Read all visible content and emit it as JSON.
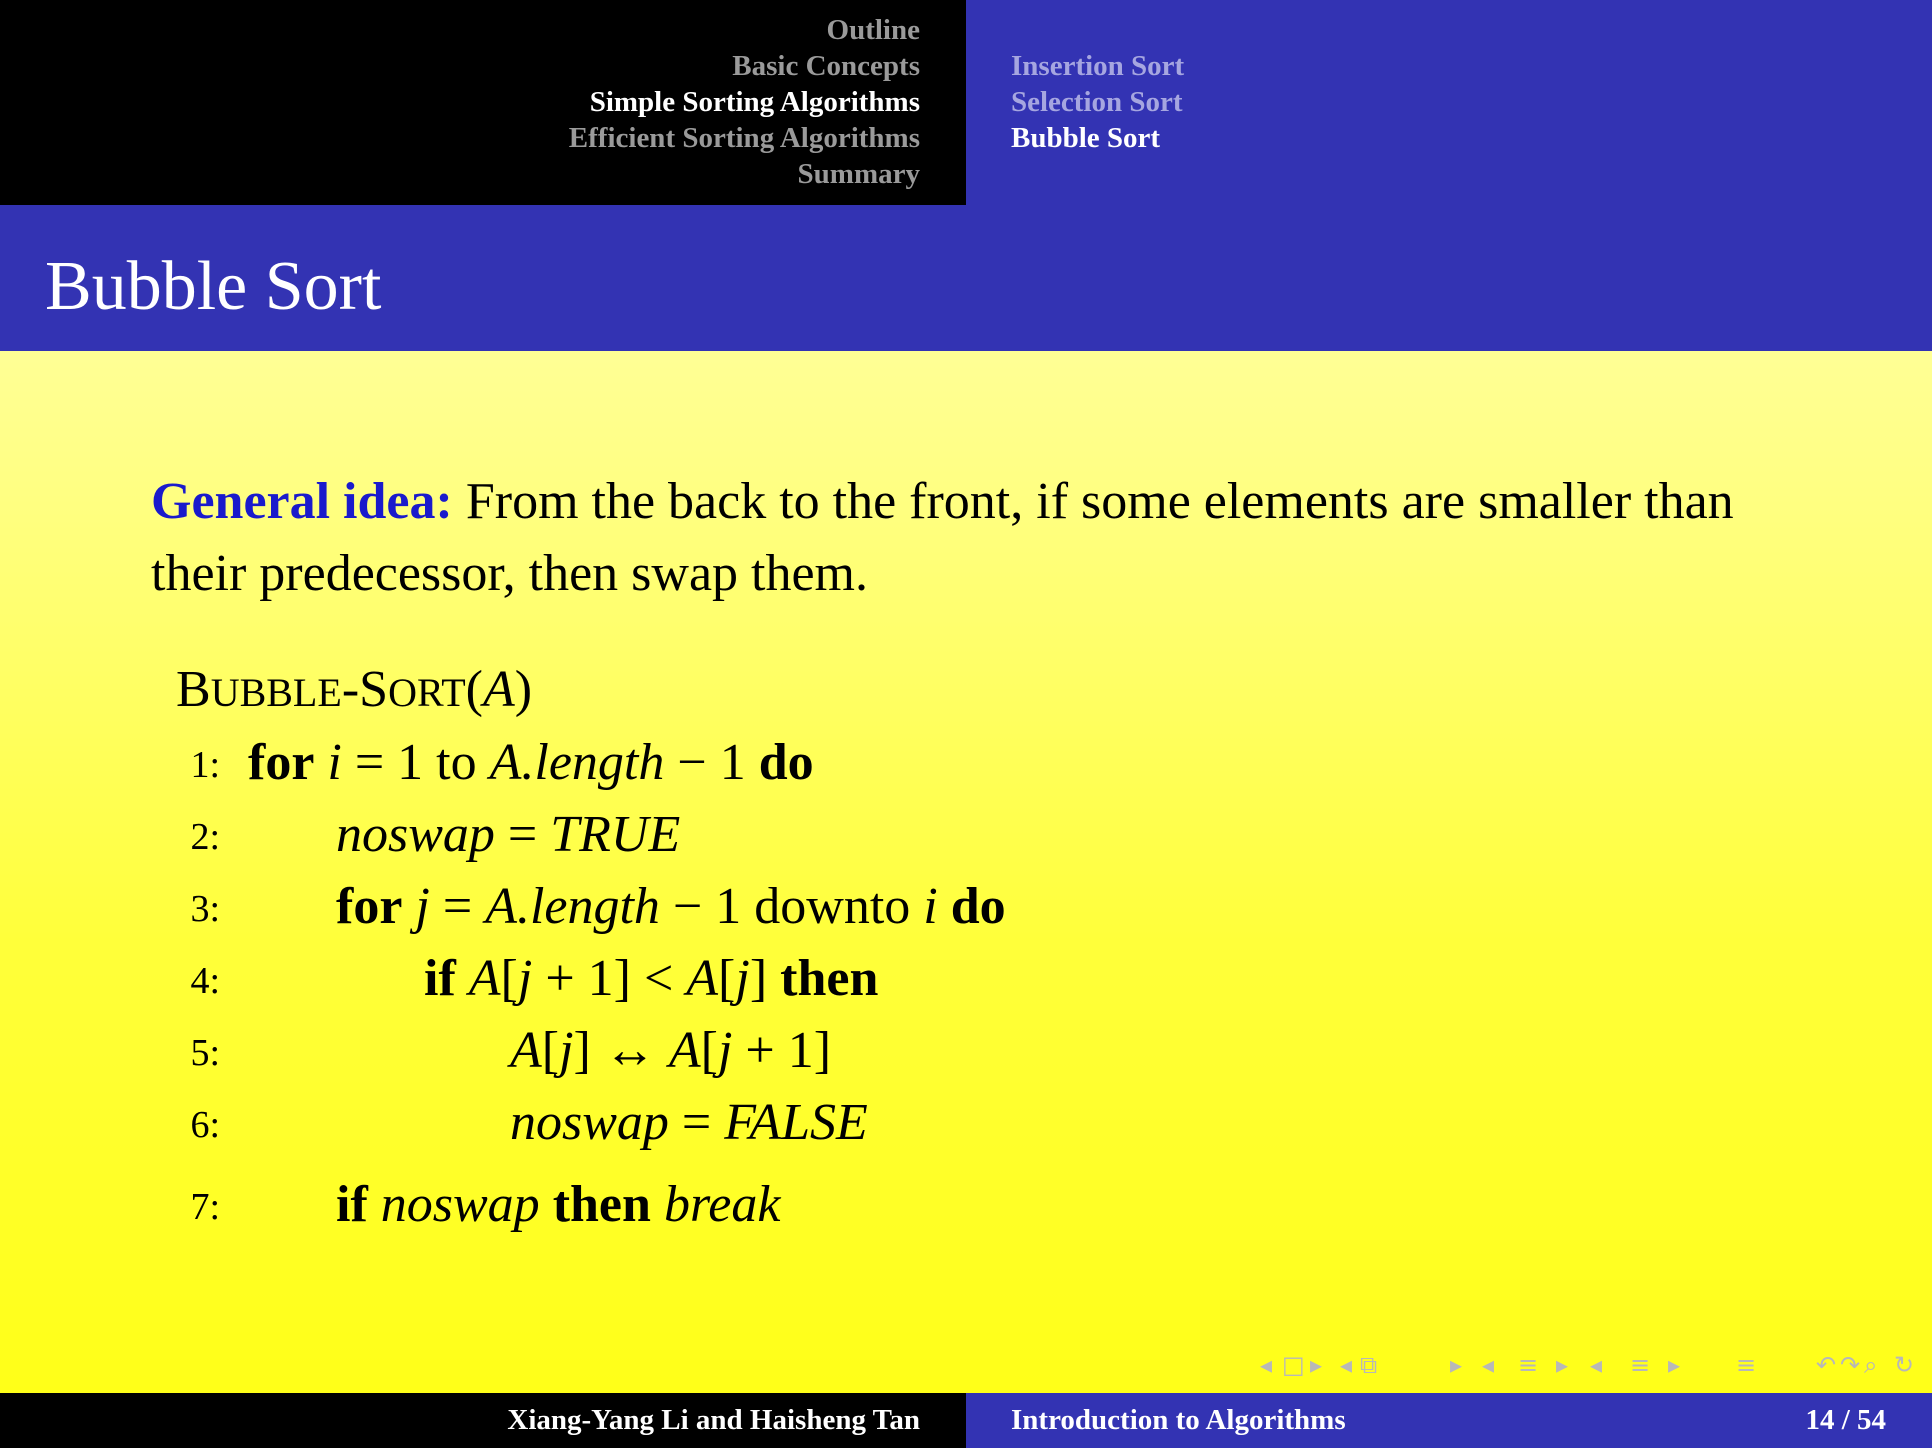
{
  "header": {
    "sections": [
      "Outline",
      "Basic Concepts",
      "Simple Sorting Algorithms",
      "Efficient Sorting Algorithms",
      "Summary"
    ],
    "active_section": "Simple Sorting Algorithms",
    "subsections": [
      "Insertion Sort",
      "Selection Sort",
      "Bubble Sort"
    ],
    "active_subsection": "Bubble Sort"
  },
  "frame": {
    "title": "Bubble Sort"
  },
  "content": {
    "idea_label": "General idea:",
    "idea_text": "From the back to the front, if some elements are smaller than their predecessor, then swap them.",
    "algorithm": {
      "name_b": "B",
      "name_ubble": "UBBLE",
      "name_dash": "-",
      "name_s": "S",
      "name_ort": "ORT",
      "param": "A",
      "lines": [
        {
          "num": "1:",
          "kw1": "for",
          "v1": "i",
          "t1": " = 1 to ",
          "v2": "A.length",
          "t2": " − 1 ",
          "kw2": "do"
        },
        {
          "num": "2:",
          "v1": "noswap",
          "t1": " = ",
          "v2": "TRUE"
        },
        {
          "num": "3:",
          "kw1": "for",
          "v1": "j",
          "t1": " = ",
          "v2": "A.length",
          "t2": " − 1 downto ",
          "v3": "i",
          "kw2": "do"
        },
        {
          "num": "4:",
          "kw1": "if",
          "v1": "A",
          "t1": "[",
          "v2": "j",
          "t2": " + 1] < ",
          "v3": "A",
          "t3": "[",
          "v4": "j",
          "t4": "] ",
          "kw2": "then"
        },
        {
          "num": "5:",
          "v1": "A",
          "t1": "[",
          "v2": "j",
          "t2": "] ↔ ",
          "v3": "A",
          "t3": "[",
          "v4": "j",
          "t4": " + 1]"
        },
        {
          "num": "6:",
          "v1": "noswap",
          "t1": " = ",
          "v2": "FALSE"
        },
        {
          "num": "7:",
          "kw1": "if",
          "v1": "noswap",
          "kw2": "then",
          "v2": "break"
        }
      ]
    }
  },
  "nav_symbols": [
    "◂",
    "□",
    "▸",
    "◂",
    "⧉",
    "▸",
    "◂",
    "≡",
    "▸",
    "◂",
    "≡",
    "▸",
    "≡",
    "↶",
    "↷",
    "⌕",
    "↻"
  ],
  "footer": {
    "authors": "Xiang-Yang Li and Haisheng Tan",
    "course": "Introduction to Algorithms",
    "page": "14 / 54"
  },
  "colors": {
    "header_left": "#000000",
    "header_right": "#3333b3",
    "title_bar": "#3333b3",
    "label_blue": "#1a1acc",
    "body_gradient_top": "#ffffc4",
    "body_gradient_bottom": "#ffff14"
  }
}
